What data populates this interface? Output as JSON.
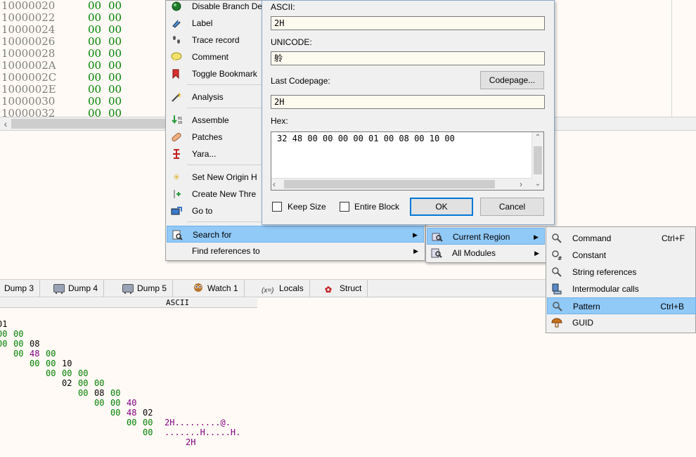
{
  "disasm": {
    "rows": [
      {
        "addr": "10000020",
        "b1": "00",
        "b2": "00"
      },
      {
        "addr": "10000022",
        "b1": "00",
        "b2": "00"
      },
      {
        "addr": "10000024",
        "b1": "00",
        "b2": "00"
      },
      {
        "addr": "10000026",
        "b1": "00",
        "b2": "00"
      },
      {
        "addr": "10000028",
        "b1": "00",
        "b2": "00"
      },
      {
        "addr": "1000002A",
        "b1": "00",
        "b2": "00"
      },
      {
        "addr": "1000002C",
        "b1": "00",
        "b2": "00"
      },
      {
        "addr": "1000002E",
        "b1": "00",
        "b2": "00"
      },
      {
        "addr": "10000030",
        "b1": "00",
        "b2": "00"
      },
      {
        "addr": "10000032",
        "b1": "00",
        "b2": "00"
      }
    ]
  },
  "context_menu": {
    "items": [
      {
        "label": "Disable Branch De",
        "icon": "green-circle-icon"
      },
      {
        "label": "Label",
        "icon": "label-icon"
      },
      {
        "label": "Trace record",
        "icon": "footprints-icon"
      },
      {
        "label": "Comment",
        "icon": "comment-bubble-icon"
      },
      {
        "label": "Toggle Bookmark",
        "icon": "bookmark-icon"
      },
      {
        "label": "Analysis",
        "icon": "magic-wand-icon"
      },
      {
        "label": "Assemble",
        "icon": "assemble-icon"
      },
      {
        "label": "Patches",
        "icon": "bandage-icon"
      },
      {
        "label": "Yara...",
        "icon": "yara-icon"
      },
      {
        "label": "Set New Origin H",
        "icon": "star-icon"
      },
      {
        "label": "Create New Thre",
        "icon": "thread-icon"
      },
      {
        "label": "Go to",
        "icon": "goto-icon"
      },
      {
        "label": "Search for",
        "icon": "search-icon"
      },
      {
        "label": "Find references to",
        "icon": ""
      }
    ]
  },
  "dialog": {
    "ascii_label": "ASCII:",
    "ascii_value": "2H",
    "unicode_label": "UNICODE:",
    "unicode_value": "䠲",
    "codepage_label": "Last Codepage:",
    "codepage_button": "Codepage...",
    "codepage_value": "2H",
    "hex_label": "Hex:",
    "hex_value": "32 48 00 00 00 00 01 00 08 00 10 00",
    "keep_size": "Keep Size",
    "entire_block": "Entire Block",
    "ok": "OK",
    "cancel": "Cancel"
  },
  "submenu1": {
    "items": [
      {
        "label": "Current Region"
      },
      {
        "label": "All Modules"
      }
    ]
  },
  "submenu2": {
    "items": [
      {
        "label": "Command",
        "shortcut": "Ctrl+F"
      },
      {
        "label": "Constant",
        "shortcut": ""
      },
      {
        "label": "String references",
        "shortcut": ""
      },
      {
        "label": "Intermodular calls",
        "shortcut": ""
      },
      {
        "label": "Pattern",
        "shortcut": "Ctrl+B"
      },
      {
        "label": "GUID",
        "shortcut": ""
      }
    ]
  },
  "tabs": [
    {
      "label": "Dump 3"
    },
    {
      "label": "Dump 4"
    },
    {
      "label": "Dump 5"
    },
    {
      "label": "Watch 1"
    },
    {
      "label": "Locals"
    },
    {
      "label": "Struct"
    }
  ],
  "hexdump": {
    "header": "ASCII",
    "rows": [
      {
        "bytes": [
          "01",
          "00",
          "08",
          "00",
          "10",
          "00",
          "00",
          "00",
          "40",
          "02"
        ],
        "ascii": "2H.........@."
      },
      {
        "bytes": [
          "00",
          "00",
          "48",
          "00",
          "00",
          "00",
          "08",
          "00",
          "48",
          "00"
        ],
        "ascii": ".......H.....H."
      },
      {
        "bytes": [
          "00",
          "00",
          "00",
          "00",
          "02",
          "00",
          "00",
          "00",
          "00",
          "00"
        ],
        "ascii": "2H"
      }
    ]
  },
  "colors": {
    "selection": "#91c9f7",
    "hex_green": "#008000",
    "hex_purple": "#800080"
  }
}
